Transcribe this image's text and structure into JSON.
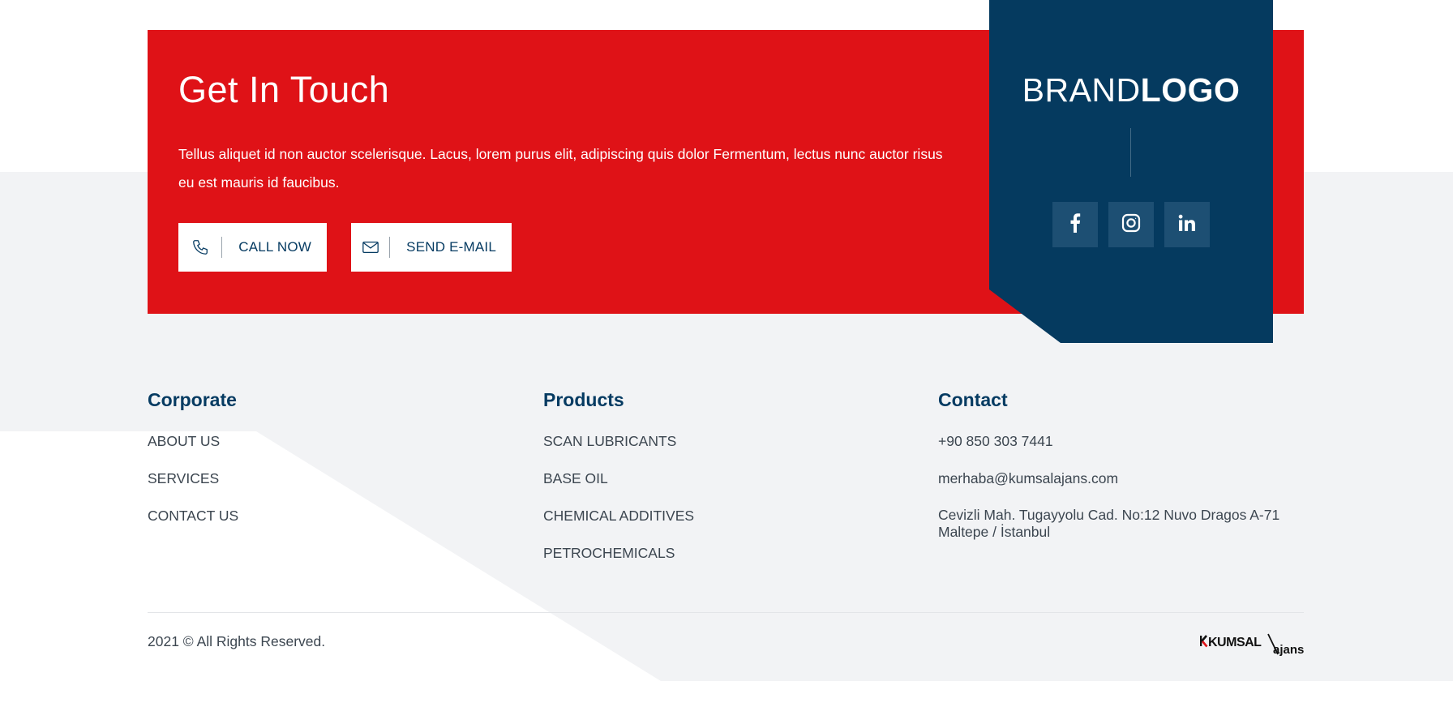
{
  "cta": {
    "title": "Get In Touch",
    "text": "Tellus aliquet id non auctor scelerisque. Lacus, lorem purus elit, adipiscing quis dolor Fermentum, lectus nunc auctor risus eu est mauris id faucibus.",
    "call_label": "CALL NOW",
    "mail_label": "SEND E-MAIL",
    "call_icon": "phone-icon",
    "mail_icon": "envelope-icon"
  },
  "brand": {
    "logo_light": "BRAND",
    "logo_bold": "LOGO",
    "socials": [
      {
        "icon": "facebook-icon"
      },
      {
        "icon": "instagram-icon"
      },
      {
        "icon": "linkedin-icon"
      }
    ]
  },
  "footer": {
    "corporate": {
      "title": "Corporate",
      "links": [
        "ABOUT US",
        "SERVICES",
        "CONTACT US"
      ]
    },
    "products": {
      "title": "Products",
      "links": [
        "SCAN LUBRICANTS",
        "BASE OIL",
        "CHEMICAL ADDITIVES",
        "PETROCHEMICALS"
      ]
    },
    "contact": {
      "title": "Contact",
      "phone": "+90 850 303 7441",
      "email": "merhaba@kumsalajans.com",
      "address_line1": "Cevizli Mah. Tugayyolu Cad. No:12 Nuvo Dragos A-71",
      "address_line2": "Maltepe / İstanbul"
    },
    "copyright": "2021 © All Rights Reserved.",
    "agency_logo": {
      "main": "KUMSAL",
      "suffix": "ajans"
    }
  },
  "colors": {
    "red": "#df1217",
    "navy": "#053a5f",
    "social_bg": "#1d4f73",
    "footer_bg": "#f2f3f5"
  }
}
